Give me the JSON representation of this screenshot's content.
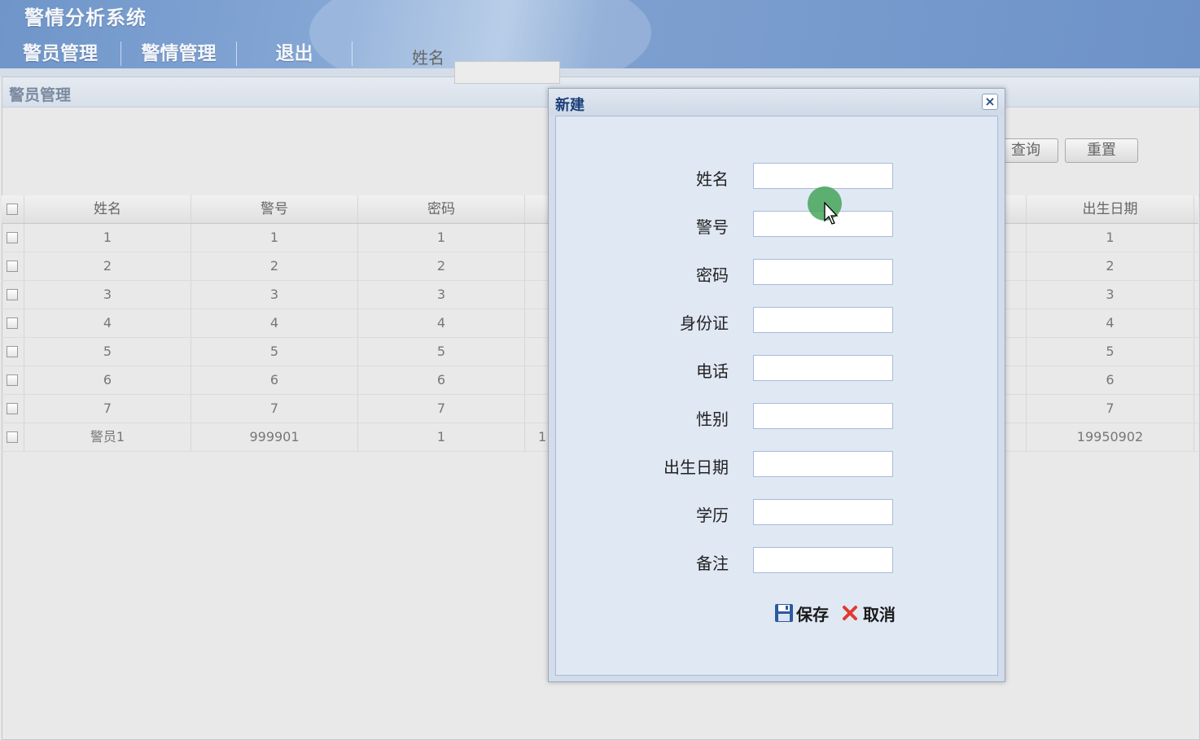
{
  "app": {
    "title": "警情分析系统"
  },
  "nav": {
    "items": [
      "警员管理",
      "警情管理",
      "退出"
    ]
  },
  "panel": {
    "title": "警员管理"
  },
  "search": {
    "name_label": "姓名",
    "name_value": "",
    "query_label": "查询",
    "reset_label": "重置"
  },
  "grid": {
    "headers": {
      "name": "姓名",
      "badge": "警号",
      "password": "密码",
      "birth": "出生日期"
    },
    "rows": [
      {
        "name": "1",
        "badge": "1",
        "password": "1",
        "partial": "",
        "birth": "1"
      },
      {
        "name": "2",
        "badge": "2",
        "password": "2",
        "partial": "",
        "birth": "2"
      },
      {
        "name": "3",
        "badge": "3",
        "password": "3",
        "partial": "",
        "birth": "3"
      },
      {
        "name": "4",
        "badge": "4",
        "password": "4",
        "partial": "",
        "birth": "4"
      },
      {
        "name": "5",
        "badge": "5",
        "password": "5",
        "partial": "",
        "birth": "5"
      },
      {
        "name": "6",
        "badge": "6",
        "password": "6",
        "partial": "",
        "birth": "6"
      },
      {
        "name": "7",
        "badge": "7",
        "password": "7",
        "partial": "",
        "birth": "7"
      },
      {
        "name": "警员1",
        "badge": "999901",
        "password": "1",
        "partial": "1",
        "birth": "19950902"
      }
    ]
  },
  "dialog": {
    "title": "新建",
    "close_icon": "close-icon",
    "fields": {
      "name": {
        "label": "姓名",
        "value": ""
      },
      "badge": {
        "label": "警号",
        "value": ""
      },
      "password": {
        "label": "密码",
        "value": ""
      },
      "id_card": {
        "label": "身份证",
        "value": ""
      },
      "phone": {
        "label": "电话",
        "value": ""
      },
      "gender": {
        "label": "性别",
        "value": ""
      },
      "birth": {
        "label": "出生日期",
        "value": ""
      },
      "education": {
        "label": "学历",
        "value": ""
      },
      "remark": {
        "label": "备注",
        "value": ""
      }
    },
    "save_label": "保存",
    "cancel_label": "取消",
    "save_icon": "floppy-disk-icon",
    "cancel_icon": "red-x-icon"
  },
  "colors": {
    "header_blue": "#7ea0d0",
    "dialog_bg": "#e0e8f4",
    "dialog_title": "#1b3f7a",
    "cancel_red": "#e03a2f",
    "save_blue": "#2c5aa0",
    "cursor_green": "#3ca050"
  }
}
